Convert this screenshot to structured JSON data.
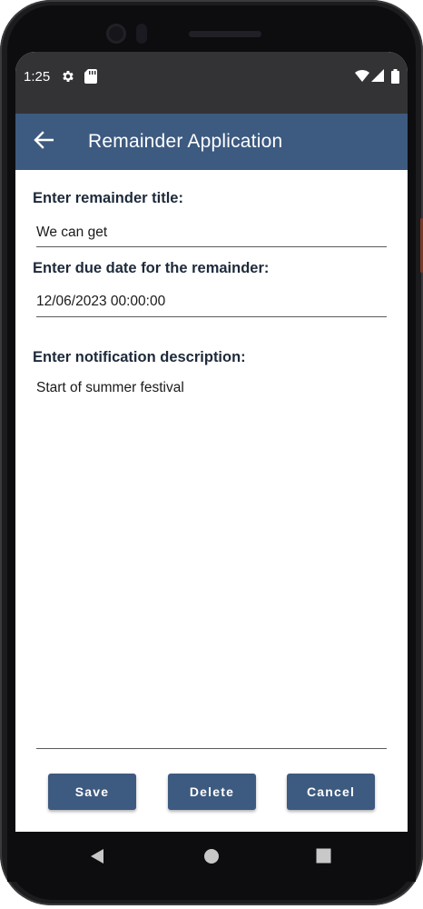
{
  "status_bar": {
    "time": "1:25",
    "icons": [
      "gear-icon",
      "sd-card-icon",
      "wifi-icon",
      "signal-icon",
      "battery-icon"
    ]
  },
  "app_bar": {
    "title": "Remainder Application",
    "back_icon": "arrow-left-icon",
    "color": "#3d5a80"
  },
  "form": {
    "title_label": "Enter remainder title:",
    "title_value": "We can get",
    "due_date_label": "Enter due date for the remainder:",
    "due_date_value": "12/06/2023 00:00:00",
    "description_label": "Enter notification description:",
    "description_value": "Start of summer festival"
  },
  "buttons": {
    "save": "Save",
    "delete": "Delete",
    "cancel": "Cancel"
  },
  "nav_bar": {
    "icons": [
      "back-triangle-icon",
      "home-circle-icon",
      "recents-square-icon"
    ]
  }
}
